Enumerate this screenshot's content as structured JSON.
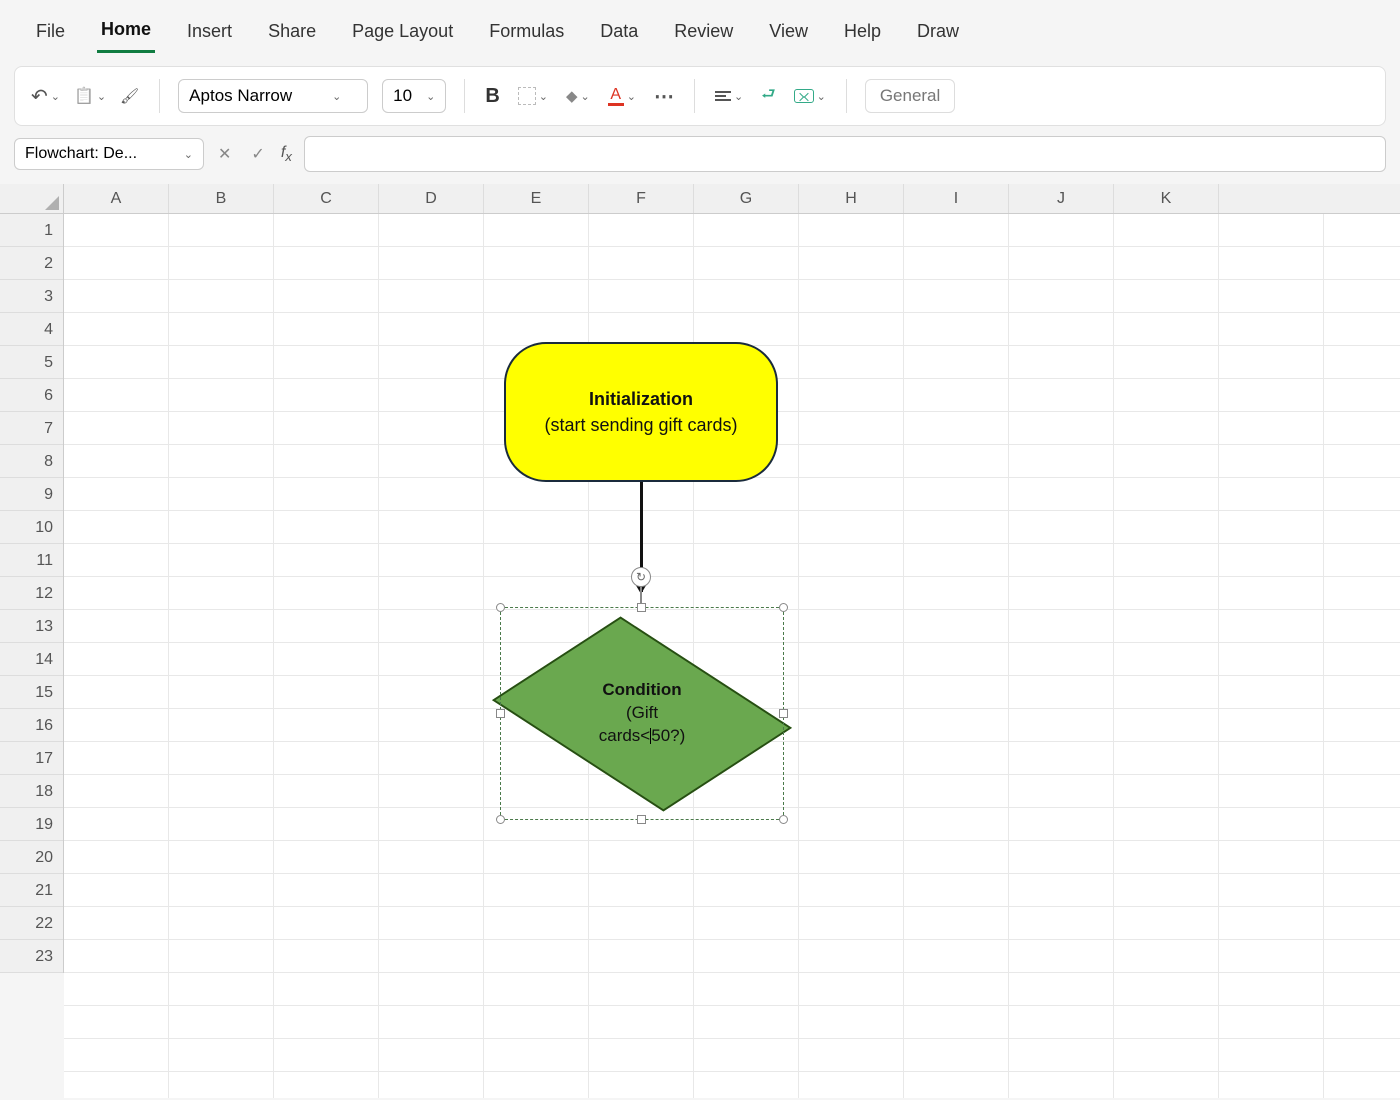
{
  "tabs": [
    "File",
    "Home",
    "Insert",
    "Share",
    "Page Layout",
    "Formulas",
    "Data",
    "Review",
    "View",
    "Help",
    "Draw"
  ],
  "activeTab": "Home",
  "toolbar": {
    "fontName": "Aptos Narrow",
    "fontSize": "10",
    "numberFormat": "General"
  },
  "nameBox": "Flowchart: De...",
  "formulaValue": "",
  "columns": [
    "A",
    "B",
    "C",
    "D",
    "E",
    "F",
    "G",
    "H",
    "I",
    "J",
    "K"
  ],
  "rows": [
    "1",
    "2",
    "3",
    "4",
    "5",
    "6",
    "7",
    "8",
    "9",
    "10",
    "11",
    "12",
    "13",
    "14",
    "15",
    "16",
    "17",
    "18",
    "19",
    "20",
    "21",
    "22",
    "23"
  ],
  "shapes": {
    "init": {
      "title": "Initialization",
      "subtitle": "(start sending gift cards)"
    },
    "condition": {
      "title": "Condition",
      "line2": "(Gift",
      "line3_pre": "cards<",
      "line3_post": "50?)"
    }
  },
  "chart_data": {
    "type": "flowchart",
    "nodes": [
      {
        "id": "init",
        "shape": "terminator",
        "label": "Initialization (start sending gift cards)",
        "fill": "#ffff00",
        "border": "#1a2b3c"
      },
      {
        "id": "cond",
        "shape": "decision",
        "label": "Condition (Gift cards < 50?)",
        "fill": "#6aa84f",
        "border": "#274e13",
        "selected": true
      }
    ],
    "edges": [
      {
        "from": "init",
        "to": "cond",
        "style": "arrow"
      }
    ]
  }
}
